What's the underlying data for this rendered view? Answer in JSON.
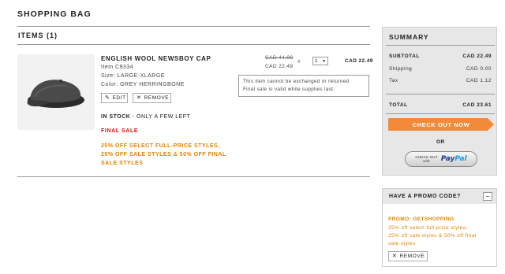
{
  "page": {
    "title": "SHOPPING BAG"
  },
  "items": {
    "header": "ITEMS (1)"
  },
  "product": {
    "name": "ENGLISH WOOL NEWSBOY CAP",
    "item_no": "Item C9334",
    "size": "Size: LARGE-XLARGE",
    "color": "Color: GREY HERRINGBONE",
    "edit_label": "EDIT",
    "remove_label": "REMOVE",
    "stock_status": "IN STOCK",
    "stock_note": " - ONLY A FEW LEFT",
    "final_sale": "FINAL SALE",
    "promo_line1": "25% OFF SELECT FULL-PRICE STYLES,",
    "promo_line2": "25% OFF SALE STYLES & 50% OFF FINAL",
    "promo_line3": "SALE STYLES",
    "price_original": "CAD 44.99",
    "price_sale": "CAD 22.49",
    "times": "x",
    "quantity": "1",
    "line_total": "CAD 22.49",
    "notice_line1": "This item cannot be exchanged or returned.",
    "notice_line2": "Final sale is valid while supplies last."
  },
  "summary": {
    "title": "SUMMARY",
    "subtotal_label": "SUBTOTAL",
    "subtotal_value": "CAD 22.49",
    "shipping_label": "Shipping",
    "shipping_value": "CAD 0.00",
    "tax_label": "Tax",
    "tax_value": "CAD 1.12",
    "total_label": "TOTAL",
    "total_value": "CAD 23.61",
    "checkout_label": "CHECK OUT NOW",
    "or_label": "OR",
    "paypal_small_line1": "CHECK OUT",
    "paypal_small_line2": "with",
    "paypal_logo_1": "Pay",
    "paypal_logo_2": "Pal"
  },
  "promo": {
    "heading": "HAVE A PROMO CODE?",
    "toggle": "–",
    "code_title": "PROMO: GETSHOPPING",
    "desc_line1": "25% off select full-price styles,",
    "desc_line2": "25% off sale styles & 50% off final",
    "desc_line3": "sale styles",
    "remove_label": "REMOVE"
  },
  "colors": {
    "accent_orange": "#f28a3a",
    "promo_text": "#e08400",
    "final_sale_red": "#cc1a1a",
    "summary_bg": "#e7e7e7"
  },
  "icons": {
    "edit": "pencil-icon",
    "remove": "close-icon",
    "qty": "chevron-down-icon"
  }
}
